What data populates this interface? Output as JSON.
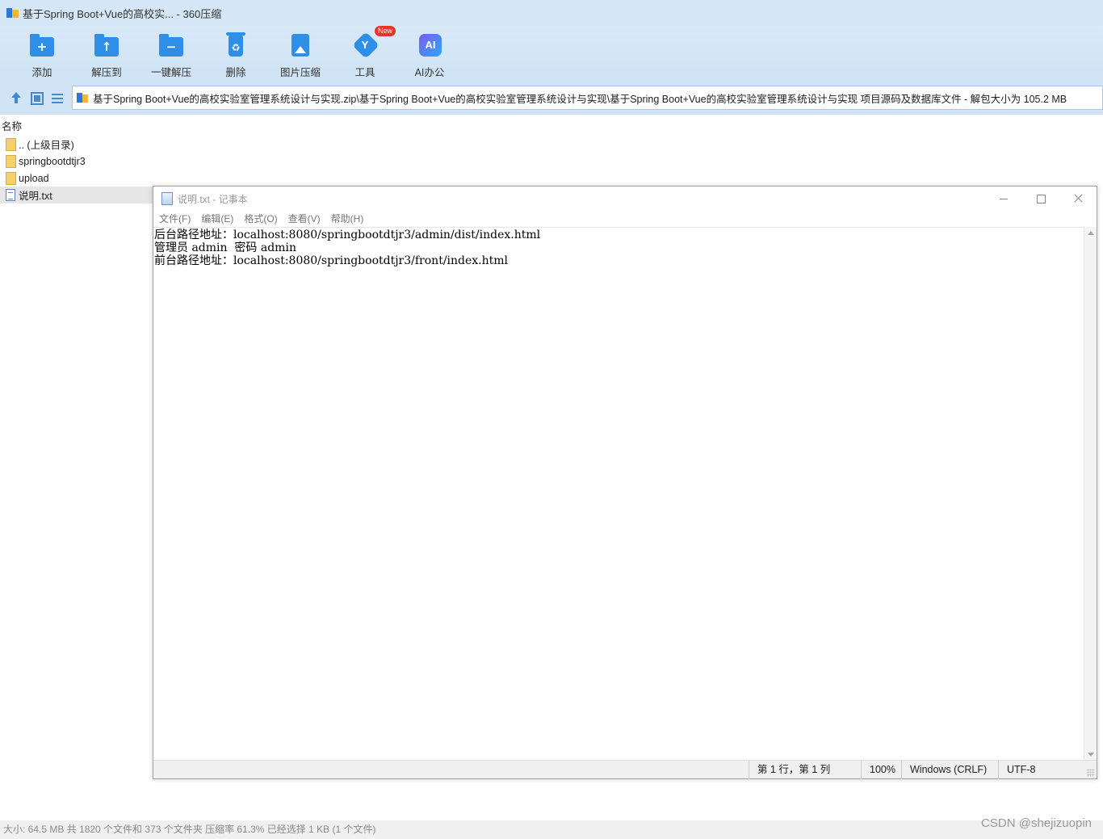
{
  "app": {
    "title": "基于Spring Boot+Vue的高校实... - 360压缩"
  },
  "toolbar": {
    "items": [
      {
        "label": "添加",
        "icon": "add-icon"
      },
      {
        "label": "解压到",
        "icon": "extract-to-icon"
      },
      {
        "label": "一键解压",
        "icon": "one-click-extract-icon"
      },
      {
        "label": "删除",
        "icon": "delete-icon"
      },
      {
        "label": "图片压缩",
        "icon": "image-compress-icon"
      },
      {
        "label": "工具",
        "icon": "tools-icon"
      },
      {
        "label": "AI办公",
        "icon": "ai-office-icon"
      }
    ],
    "tools_badge": "New",
    "ai_icon_text": "AI"
  },
  "address": {
    "path": "基于Spring Boot+Vue的高校实验室管理系统设计与实现.zip\\基于Spring Boot+Vue的高校实验室管理系统设计与实现\\基于Spring Boot+Vue的高校实验室管理系统设计与实现 项目源码及数据库文件 - 解包大小为 105.2 MB"
  },
  "list": {
    "column_name": "名称",
    "rows": [
      {
        "name": ".. (上级目录)",
        "type": "folder"
      },
      {
        "name": "springbootdtjr3",
        "type": "folder"
      },
      {
        "name": "upload",
        "type": "folder"
      },
      {
        "name": "说明.txt",
        "type": "text"
      }
    ]
  },
  "status": {
    "text": "大小: 64.5 MB 共 1820 个文件和 373 个文件夹 压缩率 61.3% 已经选择 1 KB (1 个文件)"
  },
  "watermark": "CSDN @shejizuopin",
  "notepad": {
    "title": "说明.txt - 记事本",
    "menu": [
      "文件(F)",
      "编辑(E)",
      "格式(O)",
      "查看(V)",
      "帮助(H)"
    ],
    "lines": [
      "后台路径地址：localhost:8080/springbootdtjr3/admin/dist/index.html",
      "管理员 admin  密码 admin",
      "前台路径地址：localhost:8080/springbootdtjr3/front/index.html"
    ],
    "status": {
      "position": "第 1 行，第 1 列",
      "zoom": "100%",
      "line_ending": "Windows (CRLF)",
      "encoding": "UTF-8"
    }
  },
  "colors": {
    "toolbar_bg": "#cfe3f5",
    "icon_blue": "#2f8fe6",
    "badge_red": "#e8352c"
  }
}
